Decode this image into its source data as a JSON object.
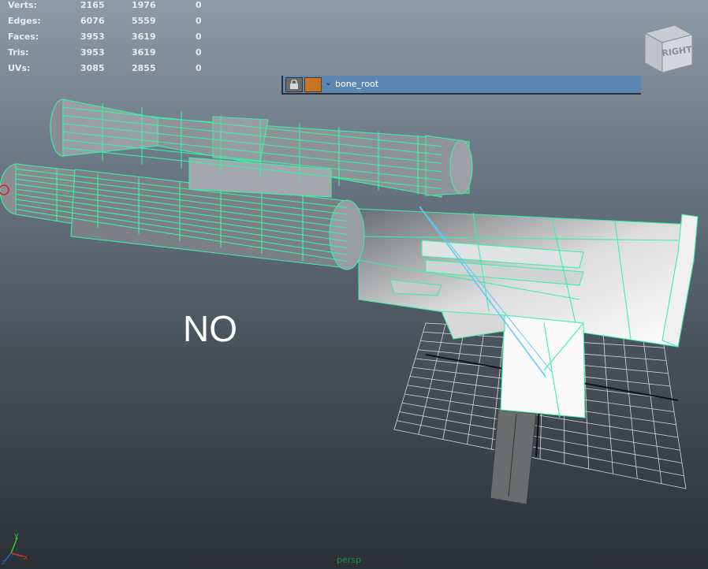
{
  "stats": [
    {
      "label": "Verts:",
      "v1": "2165",
      "v2": "1976",
      "v3": "0"
    },
    {
      "label": "Edges:",
      "v1": "6076",
      "v2": "5559",
      "v3": "0"
    },
    {
      "label": "Faces:",
      "v1": "3953",
      "v2": "3619",
      "v3": "0"
    },
    {
      "label": "Tris:",
      "v1": "3953",
      "v2": "3619",
      "v3": "0"
    },
    {
      "label": "UVs:",
      "v1": "3085",
      "v2": "2855",
      "v3": "0"
    }
  ],
  "outliner": {
    "node_name": "bone_root",
    "icons": [
      "lock-icon",
      "color-swatch"
    ]
  },
  "overlay_text": "NO",
  "viewcube_face": "RIGHT",
  "camera_label": "persp",
  "axis_labels": {
    "x": "x",
    "y": "y",
    "z": "z"
  },
  "colors": {
    "wireframe": "#3af0a5",
    "bone": "#5bc8ff",
    "outliner_bg": "#5d87b3",
    "camera_label": "#1f8a4a"
  }
}
